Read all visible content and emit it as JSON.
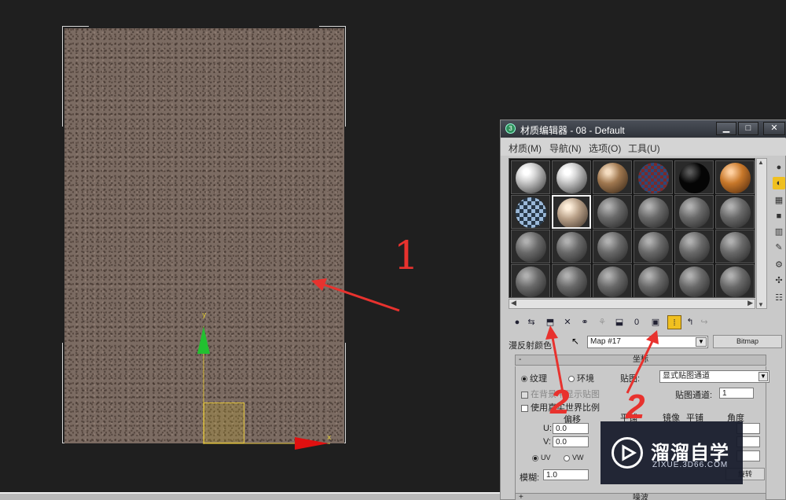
{
  "window": {
    "title": "材质编辑器 - 08 - Default",
    "buttons": {
      "minimize": "▁",
      "maximize": "□",
      "close": "✕"
    }
  },
  "menu": [
    "材质(M)",
    "导航(N)",
    "选项(O)",
    "工具(U)"
  ],
  "slots": [
    [
      "white-gloss",
      "white-gloss",
      "tan-brown",
      "checker-colored",
      "black-sparkle",
      "orange-brown"
    ],
    [
      "blue-checker",
      "beige",
      "gray",
      "gray",
      "gray",
      "gray"
    ],
    [
      "gray",
      "gray",
      "gray",
      "gray",
      "gray",
      "gray"
    ],
    [
      "gray",
      "gray",
      "gray",
      "gray",
      "gray",
      "gray"
    ]
  ],
  "active_slot": "1-1",
  "scroll": {
    "left_arrow": "◀",
    "right_arrow": "▶"
  },
  "diffuse": {
    "label": "漫反射颜色",
    "map_name": "Map #17",
    "map_type": "Bitmap"
  },
  "coordinates": {
    "title": "坐标",
    "texture_radio": "纹理",
    "environ_radio": "环境",
    "mapping_label": "贴图:",
    "mapping_value": "显式贴图通道",
    "show_bg_label": "在背景中显示贴图",
    "real_world_label": "使用真实世界比例",
    "map_channel_label": "贴图通道:",
    "map_channel_value": "1",
    "offset_label": "偏移",
    "tiling_label": "平铺",
    "mirror_label": "镜像",
    "tile_label": "平铺",
    "angle_label": "角度",
    "u_label": "U:",
    "u_value": "0.0",
    "v_label": "V:",
    "v_value": "0.0",
    "uv": "UV",
    "vw": "VW",
    "blur_label": "模糊:",
    "blur_value": "1.0",
    "rotate_button": "旋转"
  },
  "noise_rollout": "噪波",
  "annotations": {
    "one": "1",
    "two_a": "2",
    "two_b": "2"
  },
  "axis": {
    "x": "x",
    "y": "y"
  },
  "watermark": {
    "title": "溜溜自学",
    "subtitle": "ZIXUE.3D66.COM"
  },
  "colors": {
    "arrow": "#e8322e",
    "accent": "#f0c020",
    "gizmo_y": "#22c030",
    "gizmo_x": "#e01010"
  }
}
